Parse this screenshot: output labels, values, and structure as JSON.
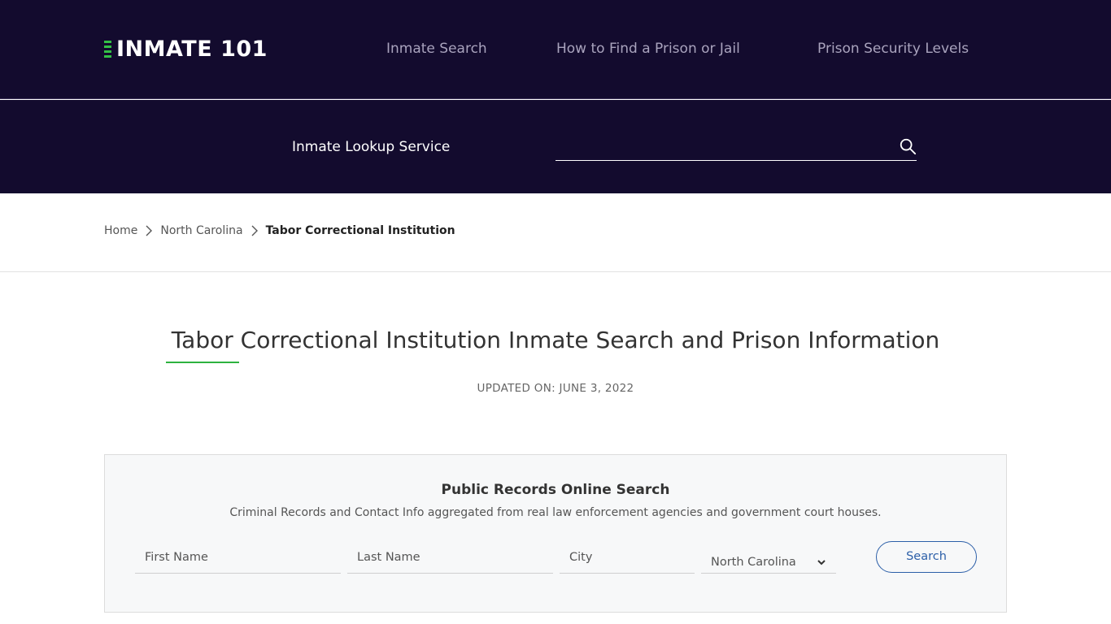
{
  "header": {
    "logo_text": "INMATE 101",
    "nav": [
      {
        "label": "Inmate Search"
      },
      {
        "label": "How to Find a Prison or Jail"
      },
      {
        "label": "Prison Security Levels"
      }
    ]
  },
  "subheader": {
    "lookup_label": "Inmate Lookup Service",
    "search_value": "",
    "search_icon": "search-icon"
  },
  "breadcrumb": {
    "items": [
      {
        "label": "Home"
      },
      {
        "label": "North Carolina"
      },
      {
        "label": "Tabor Correctional Institution"
      }
    ],
    "separator_icon": "chevron-right-icon"
  },
  "page": {
    "title": "Tabor Correctional Institution Inmate Search and Prison Information",
    "updated": "UPDATED ON: JUNE 3, 2022"
  },
  "search_card": {
    "title": "Public Records Online Search",
    "subtitle": "Criminal Records and Contact Info aggregated from real law enforcement agencies and government court houses.",
    "first_name_placeholder": "First Name",
    "last_name_placeholder": "Last Name",
    "city_placeholder": "City",
    "state_selected": "North Carolina",
    "search_label": "Search"
  },
  "colors": {
    "header_bg": "#130b2e",
    "accent_green": "#2eb23f",
    "button_blue": "#2c5fa8"
  }
}
